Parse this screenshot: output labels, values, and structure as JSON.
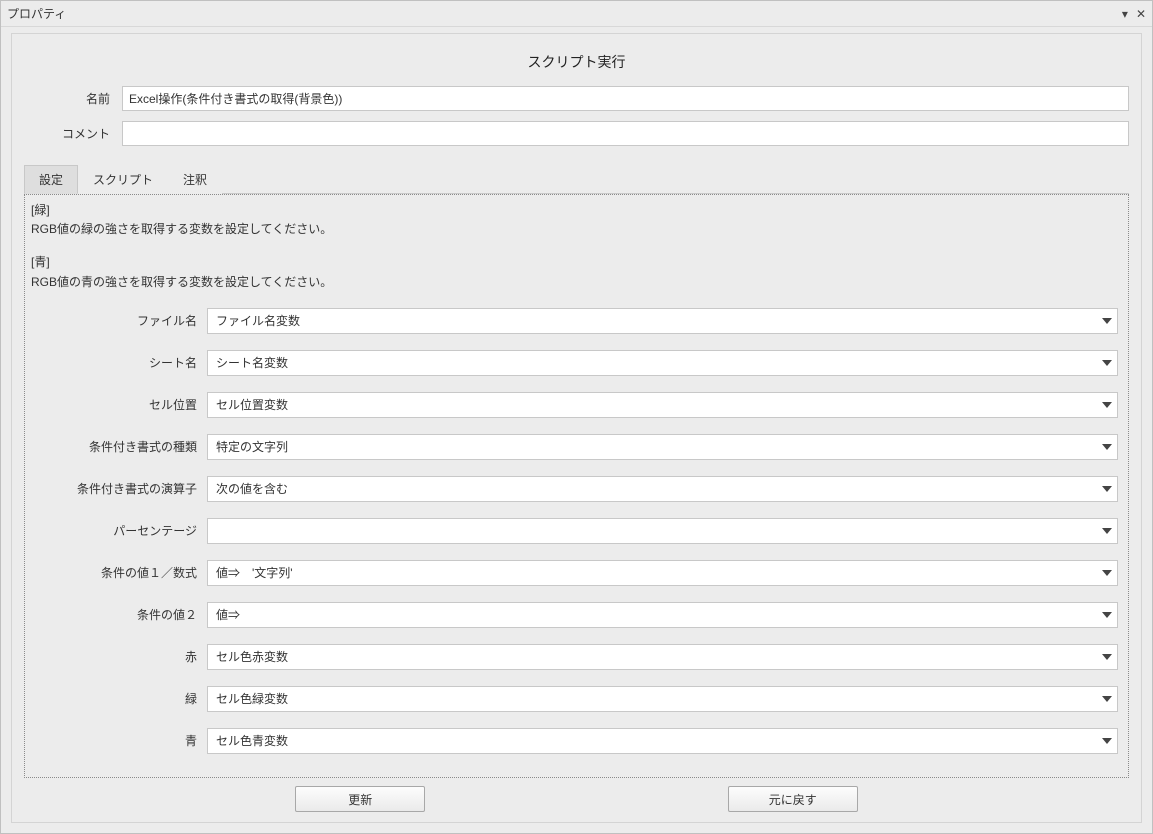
{
  "window": {
    "title": "プロパティ"
  },
  "panel": {
    "title": "スクリプト実行",
    "name_label": "名前",
    "name_value": "Excel操作(条件付き書式の取得(背景色))",
    "comment_label": "コメント",
    "comment_value": ""
  },
  "tabs": {
    "settings": "設定",
    "script": "スクリプト",
    "annotation": "注釈"
  },
  "description": {
    "green_label": "[緑]",
    "green_text": "RGB値の緑の強さを取得する変数を設定してください。",
    "blue_label": "[青]",
    "blue_text": "RGB値の青の強さを取得する変数を設定してください。"
  },
  "fields": {
    "filename": {
      "label": "ファイル名",
      "value": "ファイル名変数"
    },
    "sheetname": {
      "label": "シート名",
      "value": "シート名変数"
    },
    "cellpos": {
      "label": "セル位置",
      "value": "セル位置変数"
    },
    "cond_type": {
      "label": "条件付き書式の種類",
      "value": "特定の文字列"
    },
    "cond_operator": {
      "label": "条件付き書式の演算子",
      "value": "次の値を含む"
    },
    "percentage": {
      "label": "パーセンテージ",
      "value": ""
    },
    "cond_value1": {
      "label": "条件の値１／数式",
      "value": "値⇒　'文字列'"
    },
    "cond_value2": {
      "label": "条件の値２",
      "value": "値⇒"
    },
    "red": {
      "label": "赤",
      "value": "セル色赤変数"
    },
    "green": {
      "label": "緑",
      "value": "セル色緑変数"
    },
    "blue": {
      "label": "青",
      "value": "セル色青変数"
    }
  },
  "buttons": {
    "update": "更新",
    "revert": "元に戻す"
  }
}
